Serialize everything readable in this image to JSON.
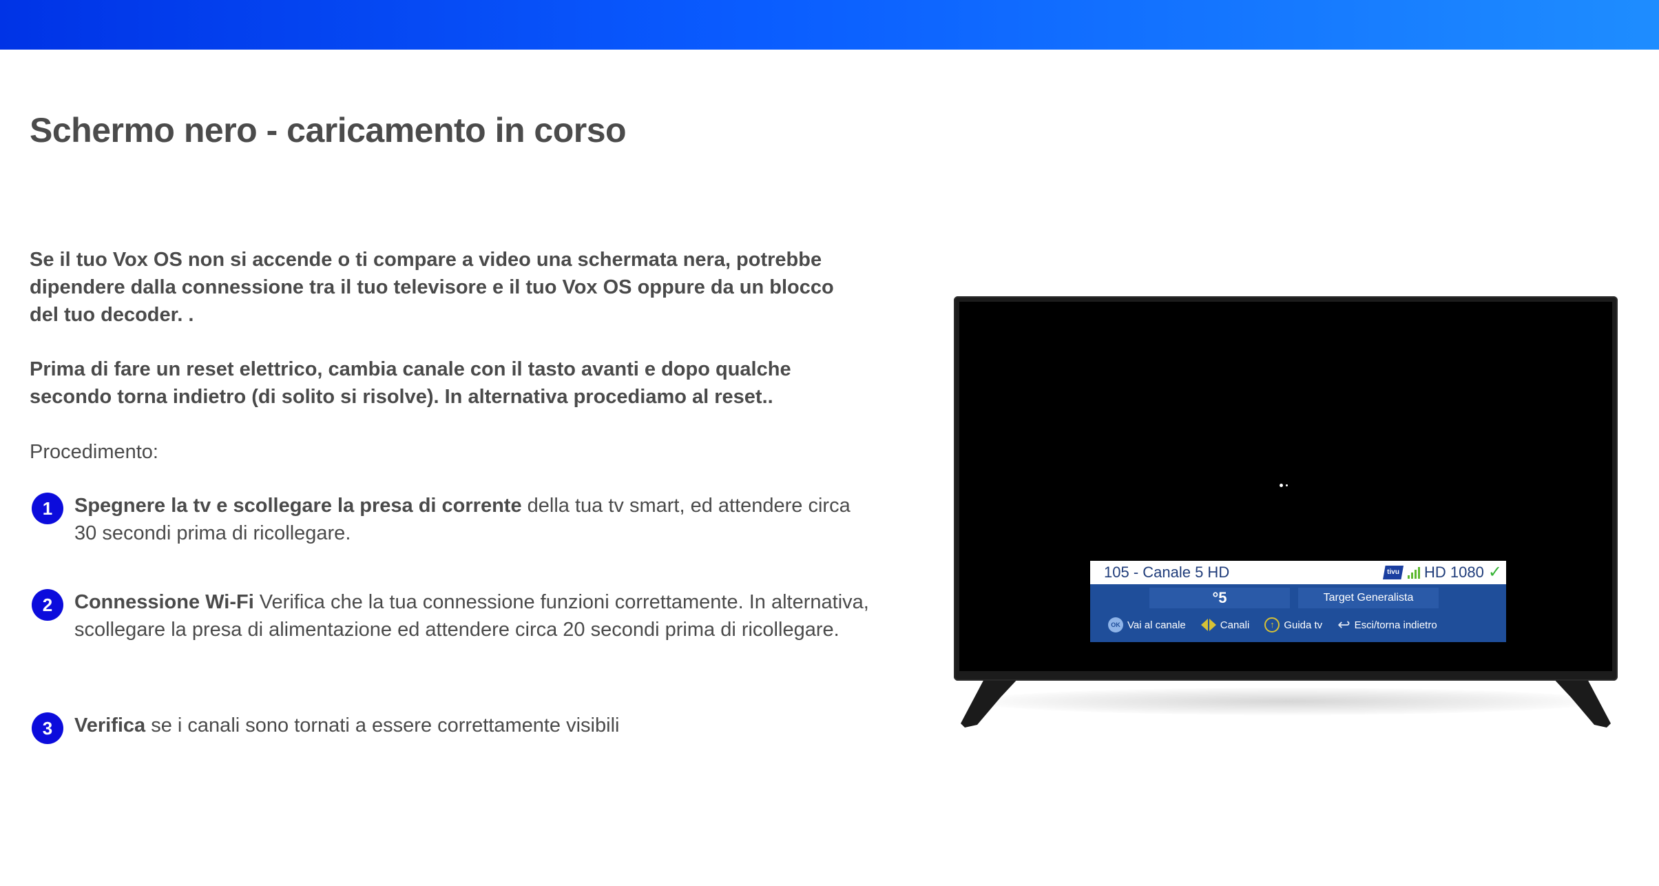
{
  "page": {
    "title": "Schermo nero - caricamento in corso",
    "intro": "Se il tuo Vox OS non si accende o ti compare a video una schermata nera, potrebbe dipendere dalla connessione tra il tuo televisore e il tuo Vox OS oppure da un blocco del tuo decoder. .",
    "advice": "Prima di fare un reset elettrico, cambia canale con il tasto avanti e dopo qualche secondo torna indietro (di solito si risolve). In alternativa procediamo al reset..",
    "procedure_label": "Procedimento:"
  },
  "steps": [
    {
      "number": "1",
      "bold": "Spegnere la tv e scollegare la presa di corrente",
      "text": " della tua tv smart, ed attendere circa 30 secondi prima di ricollegare."
    },
    {
      "number": "2",
      "bold": "Connessione Wi-Fi",
      "text": " Verifica che la tua connessione funzioni correttamente. In alternativa, scollegare la presa di alimentazione ed attendere circa 20 secondi prima di ricollegare."
    },
    {
      "number": "3",
      "bold": "Verifica",
      "text": " se i canali sono tornati a essere correttamente visibili"
    }
  ],
  "tv_overlay": {
    "channel": "105 - Canale 5 HD",
    "tivu_logo": "tivu",
    "quality": "HD 1080",
    "channel_logo": "°5",
    "program": "Target Generalista",
    "hints": [
      {
        "icon": "ok-icon",
        "key": "OK",
        "label": "Vai al canale"
      },
      {
        "icon": "left-right-arrows-icon",
        "label": "Canali"
      },
      {
        "icon": "up-arrow-icon",
        "label": "Guida tv"
      },
      {
        "icon": "back-arrow-icon",
        "label": "Esci/torna indietro"
      }
    ]
  },
  "colors": {
    "header_gradient_start": "#0033e6",
    "header_gradient_end": "#1e8dff",
    "step_badge": "#0c0cdc",
    "overlay_panel": "#1f4e9a"
  }
}
